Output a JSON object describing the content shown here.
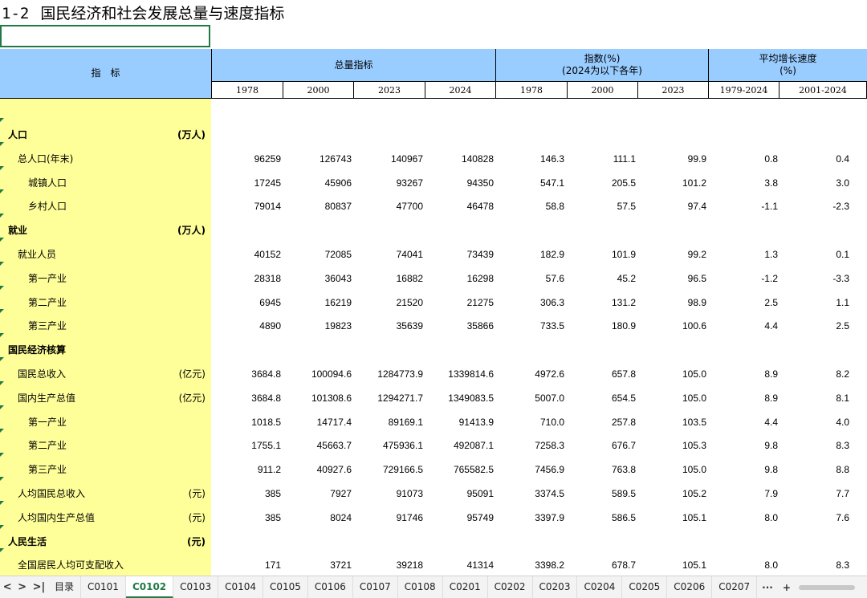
{
  "title": {
    "number": "1-2",
    "text": "国民经济和社会发展总量与速度指标"
  },
  "header": {
    "indicator": "指　标",
    "group_total": "总量指标",
    "group_index_line1": "指数(%)",
    "group_index_line2": "(2024为以下各年)",
    "group_growth_line1": "平均增长速度",
    "group_growth_line2": "(%)",
    "years": [
      "1978",
      "2000",
      "2023",
      "2024",
      "1978",
      "2000",
      "2023",
      "1979-2024",
      "2001-2024"
    ]
  },
  "rows": [
    {
      "label": "人口",
      "unit": "(万人)",
      "level": 0,
      "bold": true,
      "values": []
    },
    {
      "label": "总人口(年末)",
      "unit": "",
      "level": 1,
      "bold": false,
      "values": [
        "96259",
        "126743",
        "140967",
        "140828",
        "146.3",
        "111.1",
        "99.9",
        "0.8",
        "0.4"
      ]
    },
    {
      "label": "城镇人口",
      "unit": "",
      "level": 2,
      "bold": false,
      "values": [
        "17245",
        "45906",
        "93267",
        "94350",
        "547.1",
        "205.5",
        "101.2",
        "3.8",
        "3.0"
      ]
    },
    {
      "label": "乡村人口",
      "unit": "",
      "level": 2,
      "bold": false,
      "values": [
        "79014",
        "80837",
        "47700",
        "46478",
        "58.8",
        "57.5",
        "97.4",
        "-1.1",
        "-2.3"
      ]
    },
    {
      "label": "就业",
      "unit": "(万人)",
      "level": 0,
      "bold": true,
      "values": []
    },
    {
      "label": "就业人员",
      "unit": "",
      "level": 1,
      "bold": false,
      "values": [
        "40152",
        "72085",
        "74041",
        "73439",
        "182.9",
        "101.9",
        "99.2",
        "1.3",
        "0.1"
      ]
    },
    {
      "label": "第一产业",
      "unit": "",
      "level": 2,
      "bold": false,
      "values": [
        "28318",
        "36043",
        "16882",
        "16298",
        "57.6",
        "45.2",
        "96.5",
        "-1.2",
        "-3.3"
      ]
    },
    {
      "label": "第二产业",
      "unit": "",
      "level": 2,
      "bold": false,
      "values": [
        "6945",
        "16219",
        "21520",
        "21275",
        "306.3",
        "131.2",
        "98.9",
        "2.5",
        "1.1"
      ]
    },
    {
      "label": "第三产业",
      "unit": "",
      "level": 2,
      "bold": false,
      "values": [
        "4890",
        "19823",
        "35639",
        "35866",
        "733.5",
        "180.9",
        "100.6",
        "4.4",
        "2.5"
      ]
    },
    {
      "label": "国民经济核算",
      "unit": "",
      "level": 0,
      "bold": true,
      "values": []
    },
    {
      "label": "国民总收入",
      "unit": "(亿元)",
      "level": 1,
      "bold": false,
      "values": [
        "3684.8",
        "100094.6",
        "1284773.9",
        "1339814.6",
        "4972.6",
        "657.8",
        "105.0",
        "8.9",
        "8.2"
      ]
    },
    {
      "label": "国内生产总值",
      "unit": "(亿元)",
      "level": 1,
      "bold": false,
      "values": [
        "3684.8",
        "101308.6",
        "1294271.7",
        "1349083.5",
        "5007.0",
        "654.5",
        "105.0",
        "8.9",
        "8.1"
      ]
    },
    {
      "label": "第一产业",
      "unit": "",
      "level": 2,
      "bold": false,
      "values": [
        "1018.5",
        "14717.4",
        "89169.1",
        "91413.9",
        "710.0",
        "257.8",
        "103.5",
        "4.4",
        "4.0"
      ]
    },
    {
      "label": "第二产业",
      "unit": "",
      "level": 2,
      "bold": false,
      "values": [
        "1755.1",
        "45663.7",
        "475936.1",
        "492087.1",
        "7258.3",
        "676.7",
        "105.3",
        "9.8",
        "8.3"
      ]
    },
    {
      "label": "第三产业",
      "unit": "",
      "level": 2,
      "bold": false,
      "values": [
        "911.2",
        "40927.6",
        "729166.5",
        "765582.5",
        "7456.9",
        "763.8",
        "105.0",
        "9.8",
        "8.8"
      ]
    },
    {
      "label": "人均国民总收入",
      "unit": "(元)",
      "level": 1,
      "bold": false,
      "values": [
        "385",
        "7927",
        "91073",
        "95091",
        "3374.5",
        "589.5",
        "105.2",
        "7.9",
        "7.7"
      ]
    },
    {
      "label": "人均国内生产总值",
      "unit": "(元)",
      "level": 1,
      "bold": false,
      "values": [
        "385",
        "8024",
        "91746",
        "95749",
        "3397.9",
        "586.5",
        "105.1",
        "8.0",
        "7.6"
      ]
    },
    {
      "label": "人民生活",
      "unit": "(元)",
      "level": 0,
      "bold": true,
      "values": []
    },
    {
      "label": "全国居民人均可支配收入",
      "unit": "",
      "level": 1,
      "bold": false,
      "values": [
        "171",
        "3721",
        "39218",
        "41314",
        "3398.2",
        "678.7",
        "105.1",
        "8.0",
        "8.3"
      ]
    }
  ],
  "tabs": {
    "nav": [
      "<",
      ">",
      ">|"
    ],
    "items": [
      "目录",
      "C0101",
      "C0102",
      "C0103",
      "C0104",
      "C0105",
      "C0106",
      "C0107",
      "C0108",
      "C0201",
      "C0202",
      "C0203",
      "C0204",
      "C0205",
      "C0206",
      "C0207"
    ],
    "active": "C0102",
    "more": "···",
    "add": "+"
  },
  "colors": {
    "header_bg": "#99ccff",
    "label_bg": "#ffff99",
    "accent": "#1f7a45"
  }
}
